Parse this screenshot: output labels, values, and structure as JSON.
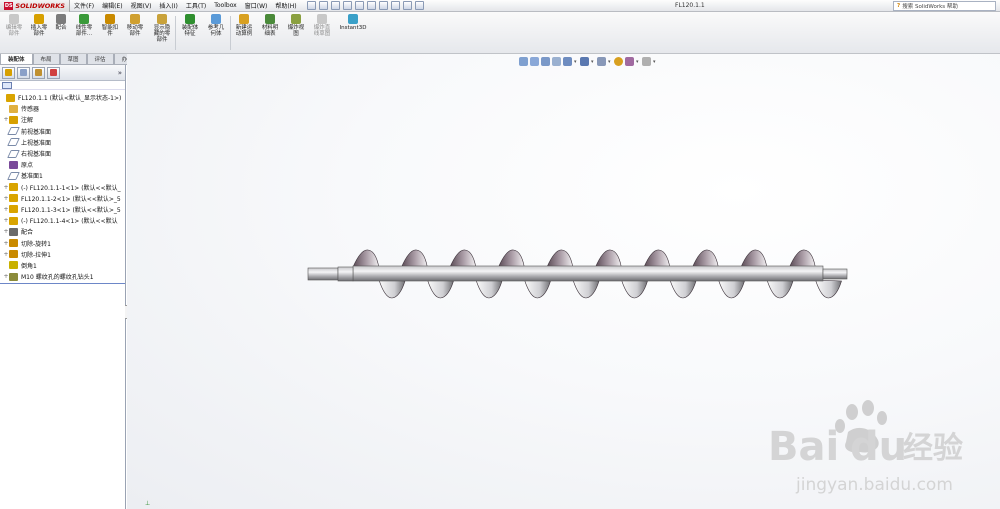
{
  "app": {
    "logo_badge": "DS",
    "logo_text": "SOLIDWORKS",
    "doc_title": "FL120.1.1",
    "help_search_placeholder": "搜索 SolidWorks 帮助"
  },
  "menu": [
    "文件(F)",
    "编辑(E)",
    "视图(V)",
    "插入(I)",
    "工具(T)",
    "Toolbox",
    "窗口(W)",
    "帮助(H)"
  ],
  "toolbar": {
    "edit_component": "编辑零\n部件",
    "insert_component": "插入零\n部件",
    "mate": "配合",
    "linear_pattern": "线性零\n部件...",
    "smart_fasteners": "智能扣\n件",
    "move_component": "移动零\n部件",
    "show_hidden": "显示隐\n藏的零\n部件",
    "assembly_features": "装配体\n特征",
    "reference_geometry": "参考几\n何体",
    "new_motion_study": "新建运\n动算例",
    "bill_of_materials": "材料明\n细表",
    "exploded_view": "爆炸视\n图",
    "explode_line_sketch": "爆炸直\n线草图",
    "instant3d": "Instant3D"
  },
  "tabs": [
    "装配体",
    "布局",
    "草图",
    "评估",
    "办公室产品"
  ],
  "active_tab": 0,
  "feature_tree": [
    {
      "label": "FL120.1.1  (默认<默认_显示状态-1>)",
      "indent": 0,
      "icon": "assembly-icon",
      "exp": ""
    },
    {
      "label": "传感器",
      "indent": 1,
      "icon": "sensor-icon",
      "exp": ""
    },
    {
      "label": "注解",
      "indent": 1,
      "icon": "annotation-icon",
      "exp": "+"
    },
    {
      "label": "前视基准面",
      "indent": 1,
      "icon": "plane-icon",
      "exp": ""
    },
    {
      "label": "上视基准面",
      "indent": 1,
      "icon": "plane-icon",
      "exp": ""
    },
    {
      "label": "右视基准面",
      "indent": 1,
      "icon": "plane-icon",
      "exp": ""
    },
    {
      "label": "原点",
      "indent": 1,
      "icon": "origin-icon",
      "exp": ""
    },
    {
      "label": "基准面1",
      "indent": 1,
      "icon": "plane-icon",
      "exp": ""
    },
    {
      "label": "(-) FL120.1.1-1<1> (默认<<默认_",
      "indent": 1,
      "icon": "part-icon",
      "exp": "+"
    },
    {
      "label": "FL120.1.1-2<1> (默认<<默认>_5",
      "indent": 1,
      "icon": "part-icon",
      "exp": "+"
    },
    {
      "label": "FL120.1.1-3<1> (默认<<默认>_5",
      "indent": 1,
      "icon": "part-icon",
      "exp": "+"
    },
    {
      "label": "(-) FL120.1.1-4<1> (默认<<默认",
      "indent": 1,
      "icon": "part-icon",
      "exp": "+"
    },
    {
      "label": "配合",
      "indent": 1,
      "icon": "mate-icon",
      "exp": "+"
    },
    {
      "label": "切除-旋转1",
      "indent": 1,
      "icon": "cut-revolve-icon",
      "exp": "+"
    },
    {
      "label": "切除-拉伸1",
      "indent": 1,
      "icon": "cut-extrude-icon",
      "exp": "+"
    },
    {
      "label": "倒角1",
      "indent": 1,
      "icon": "chamfer-icon",
      "exp": ""
    },
    {
      "label": "M10 螺纹孔的螺纹孔钻头1",
      "indent": 1,
      "icon": "hole-icon",
      "exp": "+"
    }
  ],
  "icon_colors": {
    "assembly-icon": "#d9a400",
    "sensor-icon": "#e0b040",
    "annotation-icon": "#d7a000",
    "plane-icon": "#b9c4d6",
    "origin-icon": "#7a4a9a",
    "part-icon": "#d9a400",
    "mate-icon": "#6a6a6a",
    "cut-revolve-icon": "#c98a00",
    "cut-extrude-icon": "#c98a00",
    "chamfer-icon": "#c9b100",
    "hole-icon": "#8b8b3a"
  },
  "watermark": {
    "brand": "Bai",
    "brand2": "du",
    "cn": "经验",
    "url": "jingyan.baidu.com"
  }
}
